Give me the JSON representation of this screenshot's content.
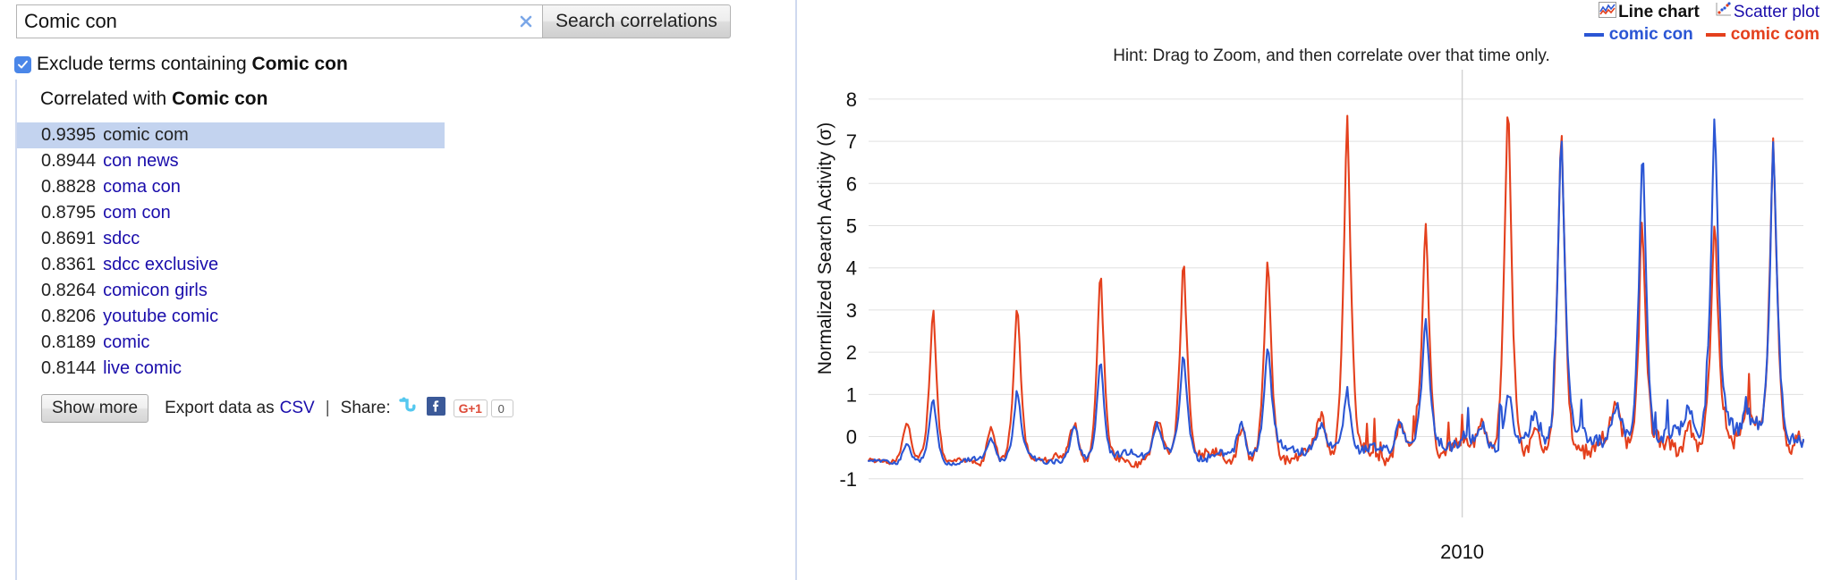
{
  "search": {
    "value": "Comic con",
    "placeholder": "Enter a search term",
    "clear_icon": "clear-x-icon",
    "button_label": "Search correlations"
  },
  "exclude": {
    "checked": true,
    "label_prefix": "Exclude terms containing ",
    "term": "Comic con"
  },
  "results": {
    "title_prefix": "Correlated with ",
    "title_term": "Comic con",
    "items": [
      {
        "value": "0.9395",
        "term": "comic com",
        "selected": true
      },
      {
        "value": "0.8944",
        "term": "con news",
        "selected": false
      },
      {
        "value": "0.8828",
        "term": "coma con",
        "selected": false
      },
      {
        "value": "0.8795",
        "term": "com con",
        "selected": false
      },
      {
        "value": "0.8691",
        "term": "sdcc",
        "selected": false
      },
      {
        "value": "0.8361",
        "term": "sdcc exclusive",
        "selected": false
      },
      {
        "value": "0.8264",
        "term": "comicon girls",
        "selected": false
      },
      {
        "value": "0.8206",
        "term": "youtube comic",
        "selected": false
      },
      {
        "value": "0.8189",
        "term": "comic",
        "selected": false
      },
      {
        "value": "0.8144",
        "term": "live comic",
        "selected": false
      }
    ]
  },
  "footer": {
    "show_more_label": "Show more",
    "export_label": "Export data as",
    "csv_label": "CSV",
    "separator": "|",
    "share_label": "Share:",
    "twitter_icon": "twitter-bird-icon",
    "facebook_icon": "facebook-f-icon",
    "gplus_label": "G+1",
    "gplus_count": "0"
  },
  "chart_toolbar": {
    "line_chart_label": "Line chart",
    "line_chart_icon": "line-chart-icon",
    "scatter_plot_label": "Scatter plot",
    "scatter_plot_icon": "scatter-plot-icon"
  },
  "hint": "Hint: Drag to Zoom, and then correlate over that time only.",
  "colors": {
    "series_comic_con": "#2b56d4",
    "series_comic_com": "#e4401d",
    "selected_row_bg": "#c3d3ef",
    "link": "#1a0dab",
    "divider": "#cfd9ef",
    "gridline": "#e0e0e0",
    "checkbox": "#4a86e8"
  },
  "chart_data": {
    "type": "line",
    "title": "",
    "xlabel": "",
    "ylabel": "Normalized Search Activity (σ)",
    "ylim": [
      -1.45,
      8.4
    ],
    "yticks": [
      -1,
      0,
      1,
      2,
      3,
      4,
      5,
      6,
      7,
      8
    ],
    "xticks": [
      "2010"
    ],
    "xtick_positions": [
      0.635
    ],
    "grid": true,
    "legend_position": "top-right",
    "legend": [
      "comic con",
      "comic com"
    ],
    "series": [
      {
        "name": "comic con",
        "color": "#2b56d4",
        "peaks": [
          {
            "x": 0.069,
            "y": 0.95
          },
          {
            "x": 0.159,
            "y": 1.05
          },
          {
            "x": 0.248,
            "y": 1.9
          },
          {
            "x": 0.337,
            "y": 1.95
          },
          {
            "x": 0.427,
            "y": 2.1
          },
          {
            "x": 0.512,
            "y": 1.25
          },
          {
            "x": 0.596,
            "y": 2.6
          },
          {
            "x": 0.684,
            "y": 1.3
          },
          {
            "x": 0.741,
            "y": 7.2
          },
          {
            "x": 0.828,
            "y": 7.15
          },
          {
            "x": 0.905,
            "y": 7.5
          },
          {
            "x": 0.968,
            "y": 6.85
          }
        ],
        "baseline": -0.62,
        "description": "Blue line: low baseline near -0.6 early, rising to ~0 later; large annual spikes in the final third reaching 6.8-7.5."
      },
      {
        "name": "comic com",
        "color": "#e4401d",
        "peaks": [
          {
            "x": 0.069,
            "y": 3.07
          },
          {
            "x": 0.159,
            "y": 3.07
          },
          {
            "x": 0.248,
            "y": 4.0
          },
          {
            "x": 0.337,
            "y": 4.2
          },
          {
            "x": 0.427,
            "y": 4.27
          },
          {
            "x": 0.512,
            "y": 7.6
          },
          {
            "x": 0.596,
            "y": 5.25
          },
          {
            "x": 0.684,
            "y": 7.8
          },
          {
            "x": 0.741,
            "y": 7.2
          },
          {
            "x": 0.828,
            "y": 4.9
          },
          {
            "x": 0.905,
            "y": 5.05
          },
          {
            "x": 0.968,
            "y": 6.85
          }
        ],
        "baseline": -0.6,
        "description": "Red line: sharp annual spikes from ~3.1 up to 7.8, with a noisy baseline around -0.6 to 0."
      }
    ],
    "notes": "Two normalized Google-Trends-style weekly time series spanning roughly 2004-2015 with a single labelled x tick at 2010. Both series show strong annual Comic-Con spikes."
  }
}
